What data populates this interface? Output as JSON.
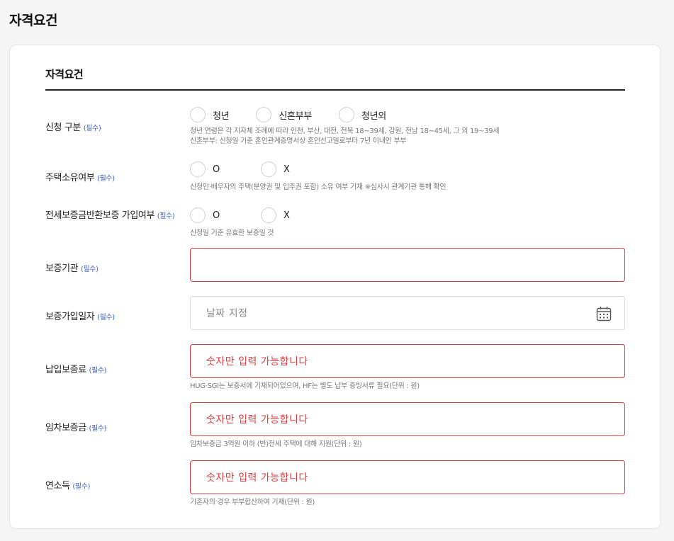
{
  "page": {
    "title": "자격요건"
  },
  "section": {
    "title": "자격요건",
    "required_tag": "(필수)"
  },
  "fields": {
    "apply_type": {
      "label": "신청 구분",
      "options": [
        "청년",
        "신혼부부",
        "청년외"
      ],
      "help": [
        "청년 연령은 각 지자체 조례에 따라 인천, 부산, 대전, 전북 18~39세, 강원, 전남 18~45세, 그 외 19~39세",
        "신혼부부: 신청일 기준 혼인관계증명서상 혼인신고일로부터 7년 이내인 부부"
      ]
    },
    "house_owned": {
      "label": "주택소유여부",
      "options": [
        "O",
        "X"
      ],
      "help": "신청인·배우자의 주택(분양권 및 입주권 포함) 소유 여부 기재 ※심사시 관계기관 통해 확인"
    },
    "guarantee_joined": {
      "label": "전세보증금반환보증 가입여부",
      "options": [
        "O",
        "X"
      ],
      "help": "신청일 기준 유효한 보증일 것"
    },
    "guarantee_org": {
      "label": "보증기관",
      "value": ""
    },
    "guarantee_date": {
      "label": "보증가입일자",
      "placeholder": "날짜 지정"
    },
    "guarantee_fee": {
      "label": "납입보증료",
      "placeholder": "숫자만 입력 가능합니다",
      "help": "HUG·SGI는 보증서에 기재되어있으며, HF는 별도 납부 증빙서류 필요(단위 : 원)"
    },
    "deposit": {
      "label": "임차보증금",
      "placeholder": "숫자만 입력 가능합니다",
      "help": "임차보증금 3억원 이하 (반)전세 주택에 대해 지원(단위 : 원)"
    },
    "income": {
      "label": "연소득",
      "placeholder": "숫자만 입력 가능합니다",
      "help": "기혼자의 경우 부부합산하여 기재(단위 : 원)"
    }
  },
  "icons": {
    "date_picker": "calendar-icon"
  },
  "colors": {
    "error": "#e03c3c",
    "required": "#3d5fc4",
    "rule": "#222222"
  }
}
